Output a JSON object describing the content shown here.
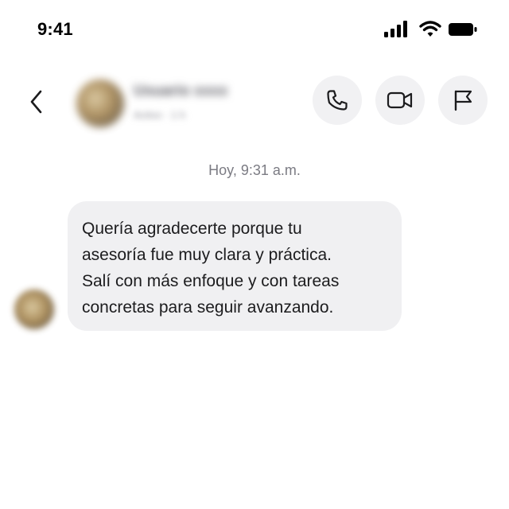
{
  "status_bar": {
    "time": "9:41",
    "icons": [
      "signal-icon",
      "wifi-icon",
      "battery-icon"
    ]
  },
  "header": {
    "contact_name": "Usuario xxxx",
    "contact_subtitle": "Activo · 1 h",
    "buttons": [
      {
        "name": "call-button",
        "icon": "phone-icon"
      },
      {
        "name": "video-button",
        "icon": "video-camera-icon"
      },
      {
        "name": "report-button",
        "icon": "flag-icon"
      }
    ]
  },
  "conversation": {
    "timestamp": "Hoy, 9:31 a.m.",
    "messages": [
      {
        "direction": "incoming",
        "lines": [
          "Quería agradecerte porque tu",
          "asesoría fue muy clara y práctica.",
          "Salí con más enfoque y con tareas",
          "concretas para seguir avanzando."
        ]
      }
    ]
  },
  "colors": {
    "bubble": "#f0f0f2",
    "icon_button_bg": "#f1f1f3",
    "timestamp": "#7b7b83",
    "text": "#1c1c1e"
  }
}
